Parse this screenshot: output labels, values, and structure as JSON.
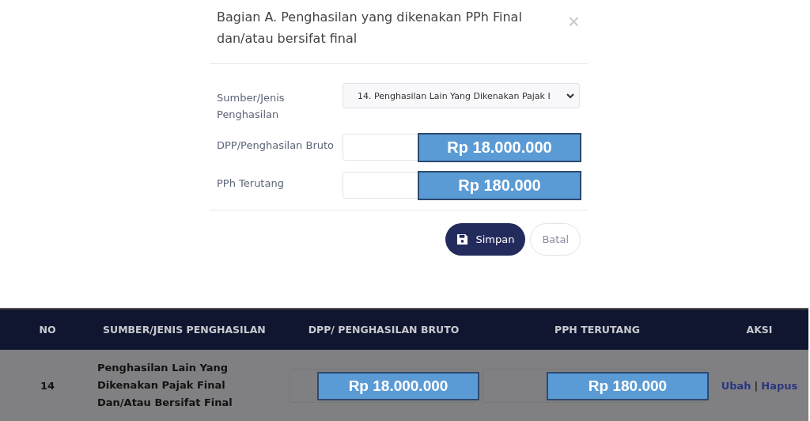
{
  "modal": {
    "title": "Bagian A. Penghasilan yang dikenakan PPh Final dan/atau bersifat final",
    "close": "×",
    "fields": [
      {
        "kind": "select",
        "label": "Sumber/Jenis Penghasilan",
        "value": "14. Penghasilan Lain Yang Dikenakan Pajak I"
      },
      {
        "kind": "amount",
        "label": "DPP/Penghasilan Bruto",
        "callout": "Rp 18.000.000"
      },
      {
        "kind": "amount",
        "label": "PPh Terutang",
        "callout": "Rp 180.000"
      }
    ],
    "buttons": [
      {
        "kind": "primary",
        "label": "Simpan"
      },
      {
        "kind": "secondary",
        "label": "Batal"
      }
    ]
  },
  "table": {
    "columns": [
      "NO",
      "SUMBER/JENIS PENGHASILAN",
      "DPP/ PENGHASILAN BRUTO",
      "PPH TERUTANG",
      "AKSI"
    ],
    "rows": [
      {
        "no": "14",
        "source": "Penghasilan Lain Yang Dikenakan Pajak Final Dan/Atau Bersifat Final",
        "dpp": "Rp 18.000.000",
        "pph": "Rp 180.000",
        "actions": [
          "Ubah",
          "Hapus"
        ],
        "separator": "|"
      }
    ]
  }
}
